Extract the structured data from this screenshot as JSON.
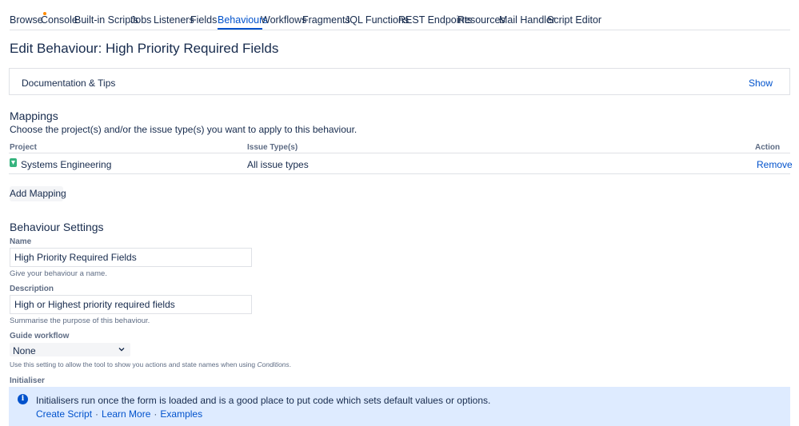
{
  "nav": {
    "items": [
      {
        "label": "Browse",
        "active": false
      },
      {
        "label": "Console",
        "active": false
      },
      {
        "label": "Built-in Scripts",
        "active": false
      },
      {
        "label": "Jobs",
        "active": false
      },
      {
        "label": "Listeners",
        "active": false
      },
      {
        "label": "Fields",
        "active": false
      },
      {
        "label": "Behaviours",
        "active": true
      },
      {
        "label": "Workflows",
        "active": false
      },
      {
        "label": "Fragments",
        "active": false
      },
      {
        "label": "JQL Functions",
        "active": false
      },
      {
        "label": "REST Endpoints",
        "active": false
      },
      {
        "label": "Resources",
        "active": false
      },
      {
        "label": "Mail Handler",
        "active": false
      },
      {
        "label": "Script Editor",
        "active": false
      }
    ]
  },
  "page": {
    "title": "Edit Behaviour: High Priority Required Fields"
  },
  "docs": {
    "label": "Documentation & Tips",
    "show": "Show"
  },
  "mappings": {
    "heading": "Mappings",
    "description": "Choose the project(s) and/or the issue type(s) you want to apply to this behaviour.",
    "columns": {
      "project": "Project",
      "issue_types": "Issue Type(s)",
      "action": "Action"
    },
    "rows": [
      {
        "project": "Systems Engineering",
        "issue_types": "All issue types",
        "action": "Remove",
        "icon": "project-icon"
      }
    ],
    "add_button": "Add Mapping"
  },
  "settings": {
    "heading": "Behaviour Settings",
    "name": {
      "label": "Name",
      "value": "High Priority Required Fields",
      "help": "Give your behaviour a name."
    },
    "description": {
      "label": "Description",
      "value": "High or Highest priority required fields",
      "help": "Summarise the purpose of this behaviour."
    },
    "guide_workflow": {
      "label": "Guide workflow",
      "value": "None",
      "help_prefix": "Use this setting to allow the tool to show you actions and state names when using ",
      "help_em": "Conditions",
      "help_suffix": "."
    },
    "initialiser": {
      "label": "Initialiser",
      "info": "Initialisers run once the form is loaded and is a good place to put code which sets default values or options.",
      "links": {
        "create": "Create Script",
        "learn": "Learn More",
        "examples": "Examples"
      },
      "separator": "·"
    }
  },
  "colors": {
    "link": "#0052cc",
    "text": "#172b4d",
    "muted": "#5e6c84",
    "info_bg": "#deebff",
    "project_icon": "#36b37e"
  }
}
